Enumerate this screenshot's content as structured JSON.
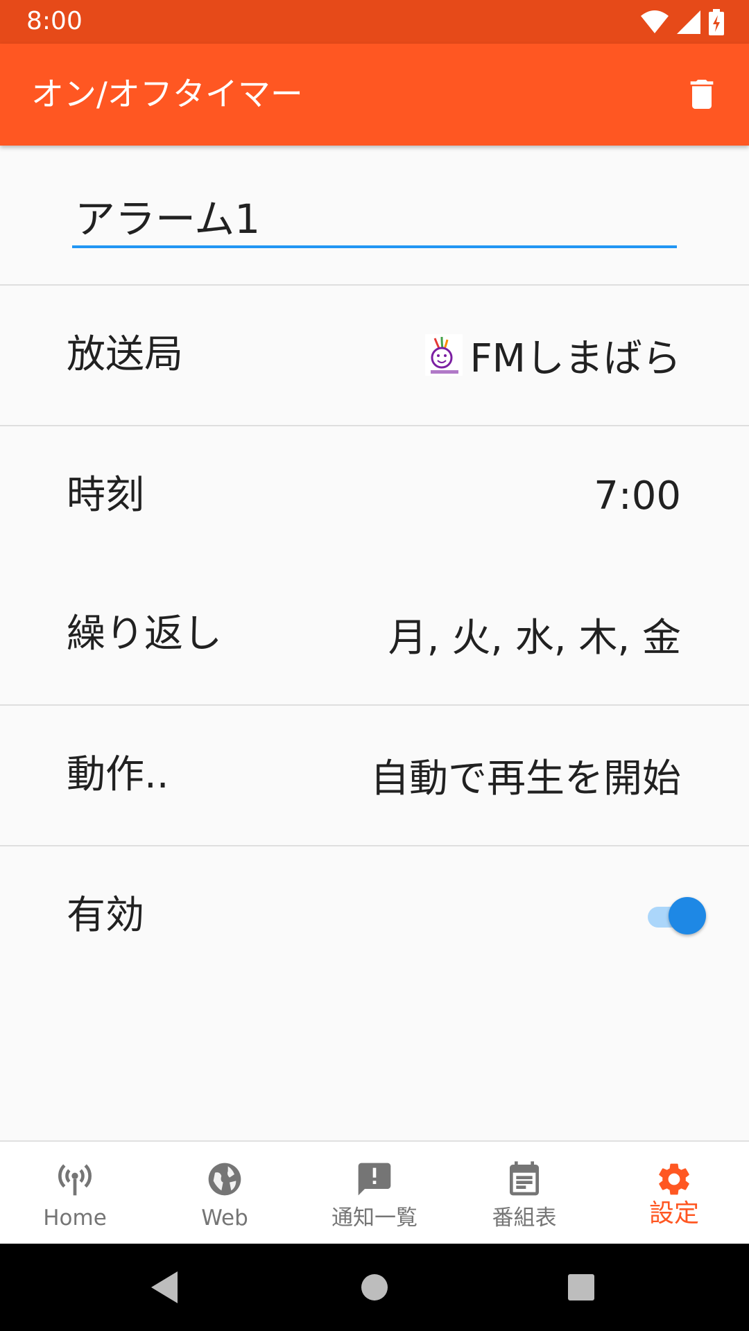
{
  "status_bar": {
    "time": "8:00"
  },
  "app_bar": {
    "title": "オン/オフタイマー",
    "delete_icon": "trash-icon"
  },
  "alarm": {
    "name": "アラーム1"
  },
  "rows": {
    "station": {
      "label": "放送局",
      "value": "FMしまばら",
      "logo_icon": "station-logo-icon"
    },
    "time": {
      "label": "時刻",
      "value": "7:00"
    },
    "repeat": {
      "label": "繰り返し",
      "value": "月, 火, 水, 木, 金"
    },
    "action": {
      "label": "動作..",
      "value": "自動で再生を開始"
    },
    "enabled": {
      "label": "有効",
      "value": true
    }
  },
  "bottom_nav": {
    "items": [
      {
        "label": "Home",
        "icon": "antenna-icon",
        "active": false
      },
      {
        "label": "Web",
        "icon": "globe-icon",
        "active": false
      },
      {
        "label": "通知一覧",
        "icon": "alert-message-icon",
        "active": false
      },
      {
        "label": "番組表",
        "icon": "calendar-icon",
        "active": false
      },
      {
        "label": "設定",
        "icon": "gear-icon",
        "active": true
      }
    ]
  },
  "colors": {
    "status_bar": "#e64a19",
    "app_bar": "#ff5722",
    "accent": "#2196f3",
    "nav_active": "#ff5722",
    "nav_inactive": "#757575"
  }
}
